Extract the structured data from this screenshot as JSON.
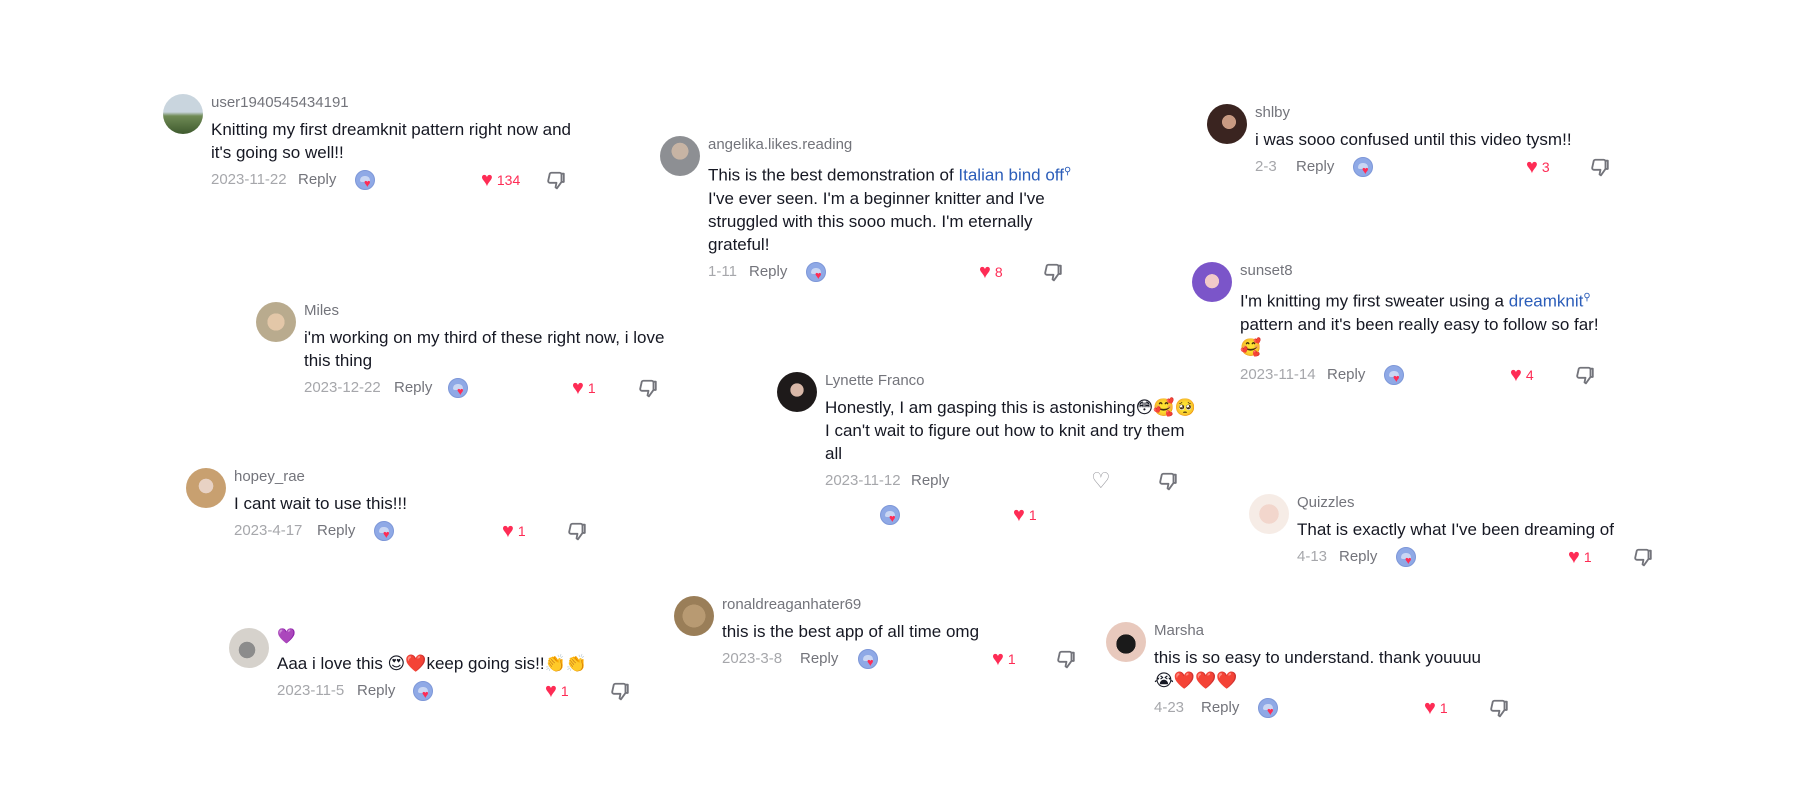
{
  "colors": {
    "like_red": "#fe2c55",
    "link_blue": "#2b5db9",
    "muted_text": "#a6a7ab",
    "username_text": "#73747b"
  },
  "icons": {
    "like": "heart-icon",
    "dislike": "thumbs-down-icon",
    "creator_liked": "creator-liked-badge",
    "search": "search-icon"
  },
  "comments": [
    {
      "username": "user1940545434191",
      "text": "Knitting my first dreamknit pattern right now and it's going so well!!",
      "date": "2023-11-22",
      "reply": "Reply",
      "likes": "134",
      "liked": true
    },
    {
      "username": "angelika.likes.reading",
      "text_before": "This is the best demonstration of ",
      "link": "Italian bind off",
      "text_after": " I've ever seen. I'm a beginner knitter and I've struggled with this sooo much. I'm eternally grateful!",
      "date": "1-11",
      "reply": "Reply",
      "likes": "8",
      "liked": true
    },
    {
      "username": "shlby",
      "text": "i was sooo confused until this video tysm!!",
      "date": "2-3",
      "reply": "Reply",
      "likes": "3",
      "liked": true
    },
    {
      "username": "sunset8",
      "text_before": "I'm knitting my first sweater using a ",
      "link": "dreamknit",
      "text_after": " pattern and it's been really easy to follow so far! 🥰",
      "date": "2023-11-14",
      "reply": "Reply",
      "likes": "4",
      "liked": true
    },
    {
      "username": "Miles",
      "text": "i'm working on my third of these right now, i love this thing",
      "date": "2023-12-22",
      "reply": "Reply",
      "likes": "1",
      "liked": true
    },
    {
      "username": "Lynette Franco",
      "text": "Honestly, I am gasping this is astonishing😳🥰🥺 I can't wait to figure out how to knit and try them all",
      "date": "2023-11-12",
      "reply": "Reply",
      "likes": "1",
      "liked": true
    },
    {
      "username": "hopey_rae",
      "text": "I cant wait to use this!!!",
      "date": "2023-4-17",
      "reply": "Reply",
      "likes": "1",
      "liked": true
    },
    {
      "username": "Quizzles",
      "text": "That is exactly what I've been dreaming of",
      "date": "4-13",
      "reply": "Reply",
      "likes": "1",
      "liked": true
    },
    {
      "username": "ronaldreaganhater69",
      "text": "this is the best app of all time omg",
      "date": "2023-3-8",
      "reply": "Reply",
      "likes": "1",
      "liked": true
    },
    {
      "username": "💜",
      "text": "Aaa i love this 😍❤️keep going sis!!👏👏",
      "date": "2023-11-5",
      "reply": "Reply",
      "likes": "1",
      "liked": true
    },
    {
      "username": "Marsha",
      "text": "this is so easy to understand. thank youuuu 😭❤️❤️❤️",
      "date": "4-23",
      "reply": "Reply",
      "likes": "1",
      "liked": true
    }
  ]
}
